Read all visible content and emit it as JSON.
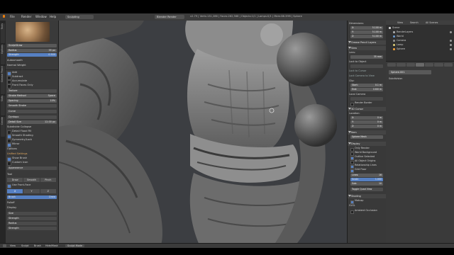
{
  "menubar": {
    "items": [
      "File",
      "Render",
      "Window",
      "Help"
    ],
    "layout": "Sculpting",
    "engine": "Blender Render",
    "stats": "v2.79 | Verts:131,286 | Faces:262,568 | Objects:1/1 | Lamps:0/1 | Mem:88.39M | Sphere"
  },
  "toolstrip": {
    "tabs": [
      "Tools",
      "Options",
      "Grease Pencil",
      "Slots",
      "Create"
    ]
  },
  "leftpanel": {
    "brush_name": "SculptDraw",
    "radius_label": "Radius",
    "radius_value": "35 px",
    "strength_label": "Strength",
    "strength_value": "0.500",
    "autosmooth_label": "Autosmooth",
    "normal_weight_label": "Normal Weight",
    "add_label": "Add",
    "subtract_label": "Subtract",
    "accumulate_label": "Accumulate",
    "front_faces_label": "Front Faces Only",
    "texture_header": "Texture",
    "stroke_header": "Stroke",
    "stroke_method_label": "Stroke Method",
    "stroke_method_value": "Space",
    "spacing_label": "Spacing",
    "spacing_value": "10%",
    "smooth_stroke_label": "Smooth Stroke",
    "curve_header": "Curve",
    "dyntopo_header": "Dyntopo",
    "detail_size_label": "Detail Size",
    "detail_size_value": "12.00 px",
    "refine_label": "Subdivide Collapse",
    "detail_flood_label": "Detail Flood Fill",
    "smooth_shading_label": "Smooth Shading",
    "symmetry_header": "Symmetry/Lock",
    "mirror_label": "Mirror",
    "mirror_tabs": [
      "X",
      "Y",
      "Z"
    ],
    "options_header": "Options",
    "unified_label": "Unified Settings",
    "size_label": "Size",
    "unified_strength_label": "Strength",
    "show_brush_label": "Show Brush",
    "appearance_header": "Appearance",
    "custom_icon_label": "Custom Icon",
    "tool_header": "Tool",
    "brush_tool_label": "Brush",
    "sculpt_tool_value": "Draw",
    "display_header": "Display",
    "radius_px_label": "Radius",
    "strength_px_label": "Strength",
    "falloff_header": "Falloff",
    "use_frontface_label": "Use Front-Face",
    "tabs": [
      "Draw",
      "Smooth",
      "Pinch"
    ]
  },
  "viewport": {
    "info": "(1) Sphere",
    "mode_label": "Sculpt Mode"
  },
  "props": {
    "dimensions_label": "Dimensions:",
    "dim_x": "5.100 m",
    "dim_y": "5.100 m",
    "dim_z": "5.100 m",
    "grease_label": "Grease Pencil Layers",
    "view_label": "View",
    "lens_label": "Lens:",
    "lens_value": "35 mm",
    "lock_label": "Lock to Object",
    "lock_cursor_label": "Lock to Cursor",
    "lock_cam_label": "Lock Camera to View",
    "clip_label": "Clip:",
    "start_value": "0.1 m",
    "end_value": "1000 m",
    "local_cam_label": "Local Camera",
    "render_border_label": "Render Border",
    "cursor_label": "3D Cursor",
    "location_label": "Location:",
    "cx": "0 m",
    "cy": "0 m",
    "cz": "0 m",
    "item_label": "Item",
    "item_name": "Sphere Mesh",
    "display_label": "Display",
    "only_render_label": "Only Render",
    "world_bg_label": "World Background",
    "outline_sel_label": "Outline Selected",
    "all_edges_label": "All Object Origins",
    "relation_label": "Relationship Lines",
    "grid_floor_label": "Grid Floor",
    "toggle_quad_label": "Toggle Quad View",
    "shading_label": "Shading",
    "matcap_label": "Matcap",
    "gsl_label": "GLSL",
    "ao_label": "Ambient Occlusion",
    "lines_value": "16",
    "scale_value": "1.000",
    "sub_value": "10"
  },
  "outliner": {
    "tabs": [
      "View",
      "Search",
      "All Scenes"
    ],
    "items": [
      {
        "name": "Scene",
        "type": "scene"
      },
      {
        "name": "RenderLayers",
        "type": "render"
      },
      {
        "name": "World",
        "type": "world"
      },
      {
        "name": "Camera",
        "type": "cam"
      },
      {
        "name": "Lamp",
        "type": "lamp"
      },
      {
        "name": "Sphere",
        "type": "mesh"
      }
    ]
  },
  "rightprops": {
    "object_name": "Sphere.001",
    "sub_label": "Subdivision"
  },
  "statusbar": {
    "items": [
      "View",
      "Sculpt",
      "Brush",
      "Hide/Mask",
      "Sculpt Mode"
    ],
    "mode_label": "Sculpt Mode"
  }
}
